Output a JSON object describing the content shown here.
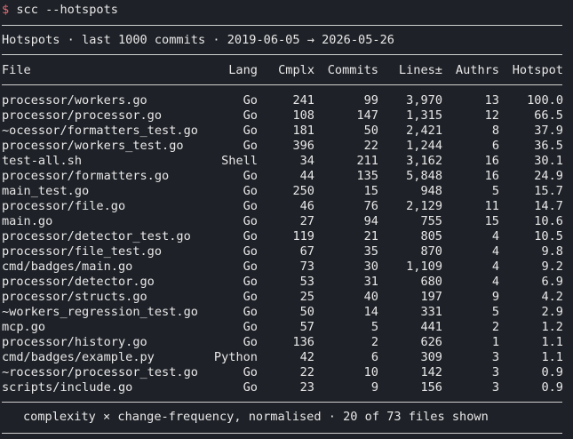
{
  "prompt": {
    "symbol": "$",
    "command": "scc --hotspots"
  },
  "title": "Hotspots · last 1000 commits · 2019-06-05 → 2026-05-26",
  "columns": {
    "file": "File",
    "lang": "Lang",
    "cmplx": "Cmplx",
    "commits": "Commits",
    "lines": "Lines±",
    "authrs": "Authrs",
    "hotspot": "Hotspot"
  },
  "rows": [
    {
      "file": "processor/workers.go",
      "lang": "Go",
      "cmplx": "241",
      "commits": "99",
      "lines": "3,970",
      "authrs": "13",
      "hotspot": "100.0"
    },
    {
      "file": "processor/processor.go",
      "lang": "Go",
      "cmplx": "108",
      "commits": "147",
      "lines": "1,315",
      "authrs": "12",
      "hotspot": "66.5"
    },
    {
      "file": "~ocessor/formatters_test.go",
      "lang": "Go",
      "cmplx": "181",
      "commits": "50",
      "lines": "2,421",
      "authrs": "8",
      "hotspot": "37.9"
    },
    {
      "file": "processor/workers_test.go",
      "lang": "Go",
      "cmplx": "396",
      "commits": "22",
      "lines": "1,244",
      "authrs": "6",
      "hotspot": "36.5"
    },
    {
      "file": "test-all.sh",
      "lang": "Shell",
      "cmplx": "34",
      "commits": "211",
      "lines": "3,162",
      "authrs": "16",
      "hotspot": "30.1"
    },
    {
      "file": "processor/formatters.go",
      "lang": "Go",
      "cmplx": "44",
      "commits": "135",
      "lines": "5,848",
      "authrs": "16",
      "hotspot": "24.9"
    },
    {
      "file": "main_test.go",
      "lang": "Go",
      "cmplx": "250",
      "commits": "15",
      "lines": "948",
      "authrs": "5",
      "hotspot": "15.7"
    },
    {
      "file": "processor/file.go",
      "lang": "Go",
      "cmplx": "46",
      "commits": "76",
      "lines": "2,129",
      "authrs": "11",
      "hotspot": "14.7"
    },
    {
      "file": "main.go",
      "lang": "Go",
      "cmplx": "27",
      "commits": "94",
      "lines": "755",
      "authrs": "15",
      "hotspot": "10.6"
    },
    {
      "file": "processor/detector_test.go",
      "lang": "Go",
      "cmplx": "119",
      "commits": "21",
      "lines": "805",
      "authrs": "4",
      "hotspot": "10.5"
    },
    {
      "file": "processor/file_test.go",
      "lang": "Go",
      "cmplx": "67",
      "commits": "35",
      "lines": "870",
      "authrs": "4",
      "hotspot": "9.8"
    },
    {
      "file": "cmd/badges/main.go",
      "lang": "Go",
      "cmplx": "73",
      "commits": "30",
      "lines": "1,109",
      "authrs": "4",
      "hotspot": "9.2"
    },
    {
      "file": "processor/detector.go",
      "lang": "Go",
      "cmplx": "53",
      "commits": "31",
      "lines": "680",
      "authrs": "4",
      "hotspot": "6.9"
    },
    {
      "file": "processor/structs.go",
      "lang": "Go",
      "cmplx": "25",
      "commits": "40",
      "lines": "197",
      "authrs": "9",
      "hotspot": "4.2"
    },
    {
      "file": "~workers_regression_test.go",
      "lang": "Go",
      "cmplx": "50",
      "commits": "14",
      "lines": "331",
      "authrs": "5",
      "hotspot": "2.9"
    },
    {
      "file": "mcp.go",
      "lang": "Go",
      "cmplx": "57",
      "commits": "5",
      "lines": "441",
      "authrs": "2",
      "hotspot": "1.2"
    },
    {
      "file": "processor/history.go",
      "lang": "Go",
      "cmplx": "136",
      "commits": "2",
      "lines": "626",
      "authrs": "1",
      "hotspot": "1.1"
    },
    {
      "file": "cmd/badges/example.py",
      "lang": "Python",
      "cmplx": "42",
      "commits": "6",
      "lines": "309",
      "authrs": "3",
      "hotspot": "1.1"
    },
    {
      "file": "~rocessor/processor_test.go",
      "lang": "Go",
      "cmplx": "22",
      "commits": "10",
      "lines": "142",
      "authrs": "3",
      "hotspot": "0.9"
    },
    {
      "file": "scripts/include.go",
      "lang": "Go",
      "cmplx": "23",
      "commits": "9",
      "lines": "156",
      "authrs": "3",
      "hotspot": "0.9"
    }
  ],
  "footer": "complexity × change-frequency, normalised · 20 of 73 files shown",
  "colors": {
    "background": "#1e2127",
    "text": "#e8e8e8",
    "prompt_symbol": "#e06c75",
    "rule": "#d0d0d0"
  }
}
